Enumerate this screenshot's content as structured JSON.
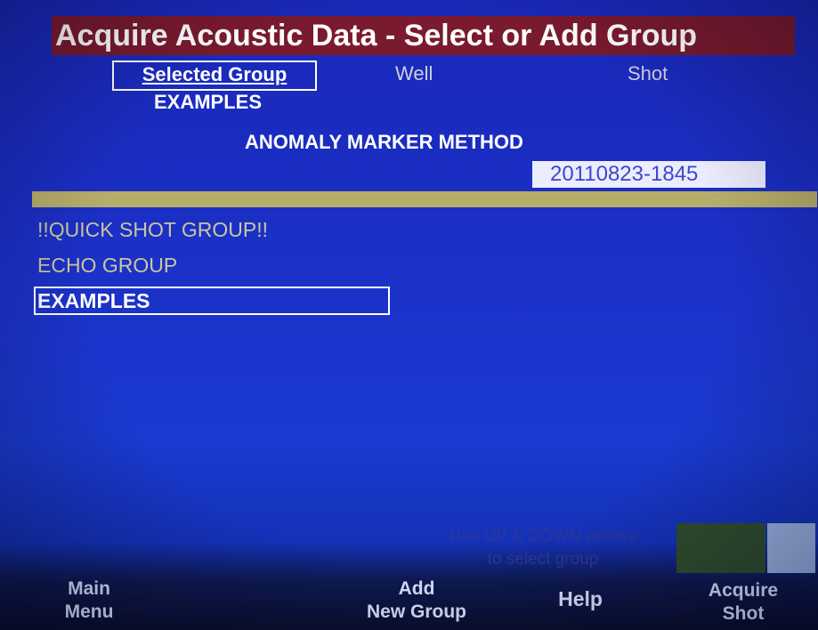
{
  "screen": {
    "title": "Acquire Acoustic Data - Select or Add Group"
  },
  "columns": {
    "selected_group": "Selected Group",
    "well": "Well",
    "shot": "Shot"
  },
  "selection": {
    "group": "EXAMPLES",
    "well": "ANOMALY MARKER METHOD",
    "shot": "20110823-1845"
  },
  "group_list": {
    "items": [
      {
        "label": "!!QUICK SHOT GROUP!!"
      },
      {
        "label": "ECHO GROUP"
      },
      {
        "label": "EXAMPLES"
      }
    ],
    "selected_index": 2
  },
  "hint": {
    "line1": "Use UP & DOWN arrows",
    "line2": "to select group"
  },
  "softkeys": {
    "main_menu": {
      "line1": "Main",
      "line2": "Menu"
    },
    "add_group": {
      "line1": "Add",
      "line2": "New Group"
    },
    "help": {
      "line1": "Help"
    },
    "acquire": {
      "line1": "Acquire",
      "line2": "Shot"
    }
  },
  "colors": {
    "background": "#1b30c7",
    "title_bar": "#7a1a2e",
    "divider": "#b7ad6a",
    "list_text": "#c9c79e",
    "selected_text": "#ffffff",
    "field_background": "#ececff",
    "field_text": "#3b49c9",
    "status_green": "#304e2e",
    "status_light": "#9ab4e4"
  }
}
